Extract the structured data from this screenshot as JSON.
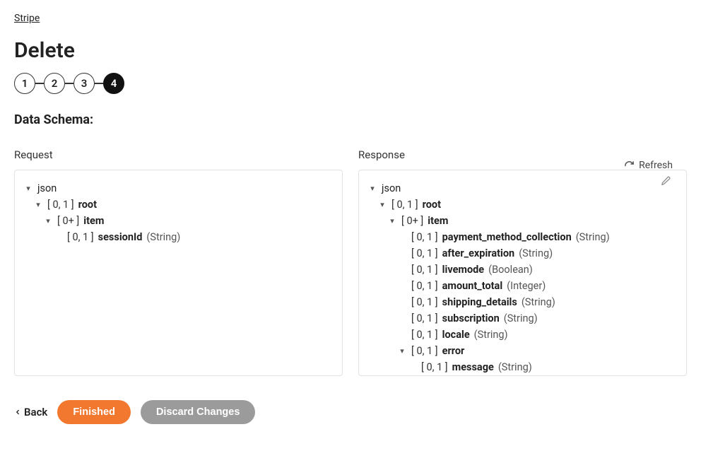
{
  "breadcrumb": {
    "label": "Stripe"
  },
  "page_title": "Delete",
  "steps": [
    {
      "label": "1",
      "active": false
    },
    {
      "label": "2",
      "active": false
    },
    {
      "label": "3",
      "active": false
    },
    {
      "label": "4",
      "active": true
    }
  ],
  "section_heading": "Data Schema:",
  "toolbar": {
    "refresh": "Refresh"
  },
  "panels": {
    "request": {
      "title": "Request",
      "tree": [
        {
          "indent": 0,
          "caret": "open",
          "card": "",
          "name": "json",
          "type": "",
          "bold": false
        },
        {
          "indent": 1,
          "caret": "open",
          "card": "[ 0, 1 ]",
          "name": "root",
          "type": ""
        },
        {
          "indent": 2,
          "caret": "open",
          "card": "[ 0+ ]",
          "name": "item",
          "type": ""
        },
        {
          "indent": 3,
          "caret": "none",
          "card": "[ 0, 1 ]",
          "name": "sessionId",
          "type": "(String)"
        }
      ]
    },
    "response": {
      "title": "Response",
      "tree": [
        {
          "indent": 0,
          "caret": "open",
          "card": "",
          "name": "json",
          "type": "",
          "bold": false
        },
        {
          "indent": 1,
          "caret": "open",
          "card": "[ 0, 1 ]",
          "name": "root",
          "type": ""
        },
        {
          "indent": 2,
          "caret": "open",
          "card": "[ 0+ ]",
          "name": "item",
          "type": ""
        },
        {
          "indent": 3,
          "caret": "none",
          "card": "[ 0, 1 ]",
          "name": "payment_method_collection",
          "type": "(String)"
        },
        {
          "indent": 3,
          "caret": "none",
          "card": "[ 0, 1 ]",
          "name": "after_expiration",
          "type": "(String)"
        },
        {
          "indent": 3,
          "caret": "none",
          "card": "[ 0, 1 ]",
          "name": "livemode",
          "type": "(Boolean)"
        },
        {
          "indent": 3,
          "caret": "none",
          "card": "[ 0, 1 ]",
          "name": "amount_total",
          "type": "(Integer)"
        },
        {
          "indent": 3,
          "caret": "none",
          "card": "[ 0, 1 ]",
          "name": "shipping_details",
          "type": "(String)"
        },
        {
          "indent": 3,
          "caret": "none",
          "card": "[ 0, 1 ]",
          "name": "subscription",
          "type": "(String)"
        },
        {
          "indent": 3,
          "caret": "none",
          "card": "[ 0, 1 ]",
          "name": "locale",
          "type": "(String)"
        },
        {
          "indent": 3,
          "caret": "open",
          "card": "[ 0, 1 ]",
          "name": "error",
          "type": ""
        },
        {
          "indent": 4,
          "caret": "none",
          "card": "[ 0, 1 ]",
          "name": "message",
          "type": "(String)"
        }
      ]
    }
  },
  "footer": {
    "back": "Back",
    "finished": "Finished",
    "discard": "Discard Changes"
  }
}
